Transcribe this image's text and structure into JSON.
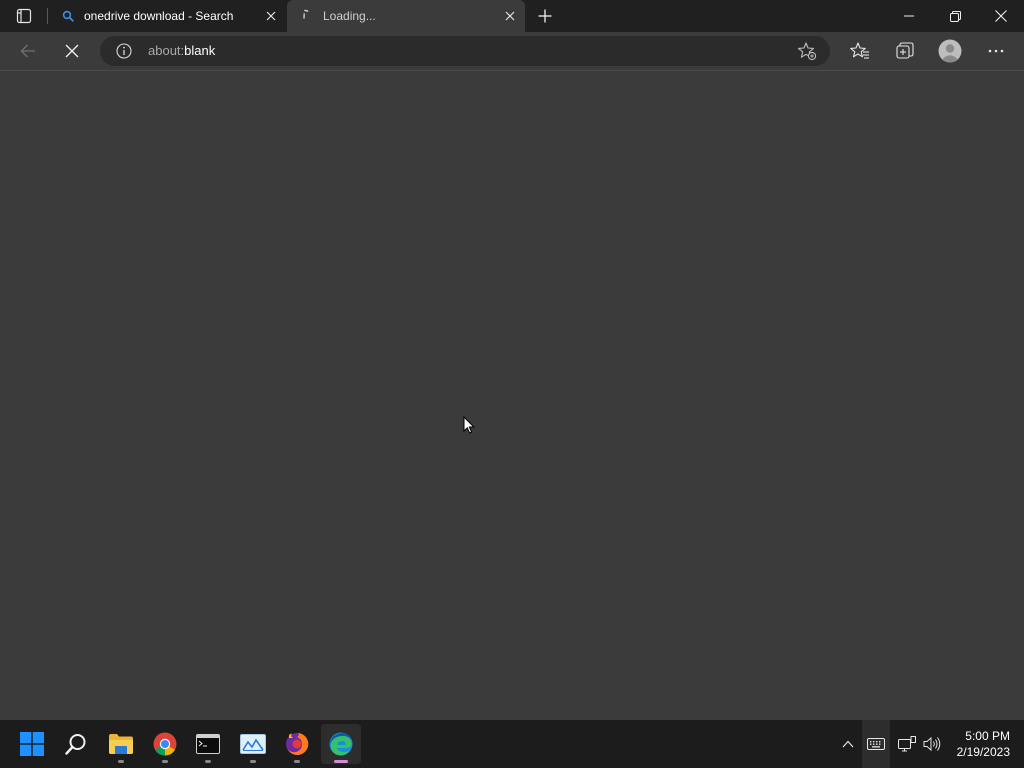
{
  "browser": {
    "tabs": [
      {
        "title": "onedrive download - Search",
        "icon": "search-icon",
        "active": false
      },
      {
        "title": "Loading...",
        "icon": "loading-spinner-icon",
        "active": true
      }
    ],
    "address_bar": {
      "scheme": "about:",
      "host": "blank"
    },
    "colors": {
      "tab_bar": "#202020",
      "page_background": "#3b3b3b",
      "address_field": "#2b2b2b",
      "search_accent": "#3b8eea"
    }
  },
  "taskbar": {
    "apps": [
      {
        "name": "start",
        "icon": "windows-logo-icon"
      },
      {
        "name": "search",
        "icon": "search-icon"
      },
      {
        "name": "file-explorer",
        "icon": "folder-icon",
        "running": true
      },
      {
        "name": "chrome",
        "icon": "chrome-icon",
        "running": true
      },
      {
        "name": "terminal",
        "icon": "terminal-icon",
        "running": true
      },
      {
        "name": "photos",
        "icon": "photos-icon",
        "running": true
      },
      {
        "name": "firefox",
        "icon": "firefox-icon",
        "running": true
      },
      {
        "name": "edge",
        "icon": "edge-icon",
        "running": true,
        "active": true
      }
    ],
    "clock": {
      "time": "5:00 PM",
      "date": "2/19/2023"
    }
  }
}
